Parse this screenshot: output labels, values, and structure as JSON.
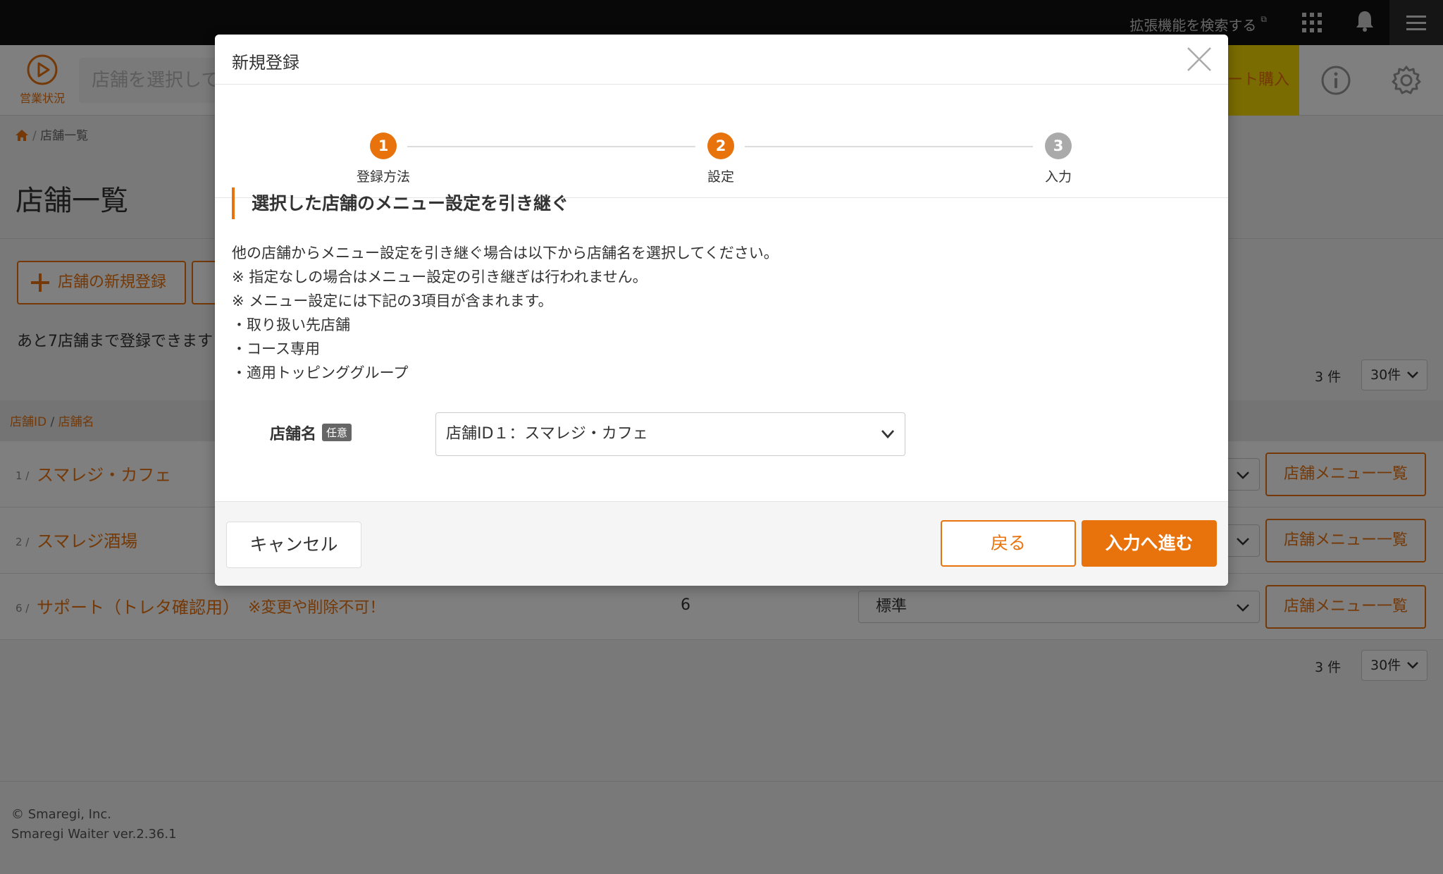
{
  "topbar": {
    "ext_search": "拡張機能を検索する"
  },
  "header": {
    "status_label": "営業状況",
    "store_placeholder": "店舗を選択して",
    "ticket_label": "ート購入"
  },
  "page": {
    "breadcrumb": "店舗一覧",
    "title": "店舗一覧",
    "new_button": "店舗の新規登録",
    "remain_text": "あと7店舗まで登録できます",
    "count_text": "3 件",
    "per_page": "30件",
    "table_header_id": "店舗ID",
    "table_header_name": "店舗名",
    "rows": [
      {
        "id": "1 /",
        "name": "スマレジ・カフェ",
        "note": "",
        "num": "",
        "select": "",
        "button": "店舗メニュー一覧"
      },
      {
        "id": "2 /",
        "name": "スマレジ酒場",
        "note": "",
        "num": "",
        "select": "",
        "button": "店舗メニュー一覧"
      },
      {
        "id": "6 /",
        "name": "サポート（トレタ確認用）",
        "note": "※変更や削除不可！",
        "num": "6",
        "select": "標準",
        "button": "店舗メニュー一覧"
      }
    ]
  },
  "footer": {
    "copyright": "© Smaregi, Inc.",
    "version": "Smaregi Waiter ver.2.36.1"
  },
  "modal": {
    "title": "新規登録",
    "steps": [
      {
        "num": "1",
        "label": "登録方法",
        "state": "active"
      },
      {
        "num": "2",
        "label": "設定",
        "state": "active"
      },
      {
        "num": "3",
        "label": "入力",
        "state": "inactive"
      }
    ],
    "section_title": "選択した店舗のメニュー設定を引き継ぐ",
    "desc_lines": [
      "他の店舗からメニュー設定を引き継ぐ場合は以下から店舗名を選択してください。",
      "※ 指定なしの場合はメニュー設定の引き継ぎは行われません。",
      "※ メニュー設定には下記の3項目が含まれます。",
      "・取り扱い先店舗",
      "・コース専用",
      "・適用トッピンググループ"
    ],
    "field_label": "店舗名",
    "field_badge": "任意",
    "field_value": "店舗ID１：スマレジ・カフェ",
    "cancel": "キャンセル",
    "back": "戻る",
    "next": "入力へ進む"
  },
  "colors": {
    "accent": "#e8720c",
    "topbar": "#111111",
    "ticket": "#f5d800"
  }
}
